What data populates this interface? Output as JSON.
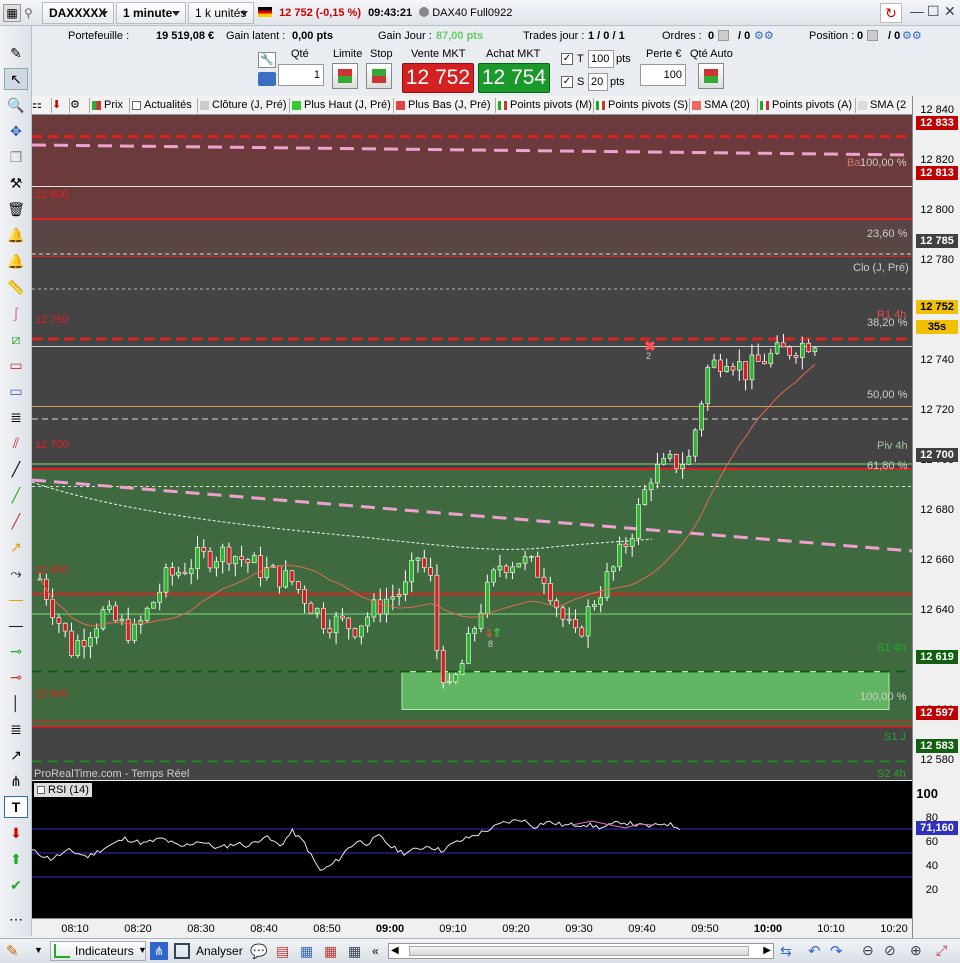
{
  "titlebar": {
    "instrument": "DAXXXXX",
    "timeframe": "1 minute",
    "units": "1 k unités",
    "last_quote": "12 752 (-0,15 %)",
    "time": "09:43:21",
    "contract": "DAX40 Full0922"
  },
  "account": {
    "portfolio_label": "Portefeuille :",
    "portfolio_value": "19 519,08 €",
    "latent_label": "Gain latent :",
    "latent_value": "0,00 pts",
    "day_label": "Gain Jour :",
    "day_value": "87,00 pts",
    "trades_label": "Trades jour :",
    "trades_value": "1 / 0 / 1",
    "orders_label": "Ordres :",
    "orders_value1": "0",
    "orders_value2": "/ 0",
    "position_label": "Position :",
    "position_value1": "0",
    "position_value2": "/ 0"
  },
  "order": {
    "qty_label": "Qté",
    "qty_value": "1",
    "limit_label": "Limite",
    "stop_label": "Stop",
    "sell_label": "Vente MKT",
    "sell_price": "12 752",
    "buy_label": "Achat MKT",
    "buy_price": "12 754",
    "t_label": "T",
    "t_value": "100",
    "s_label": "S",
    "s_value": "20",
    "pts": "pts",
    "loss_label": "Perte €",
    "loss_value": "100",
    "auto_label": "Qté Auto"
  },
  "indicators": [
    {
      "label": "Prix",
      "color": "#c04040"
    },
    {
      "label": "Actualités",
      "color": "#6060a0"
    },
    {
      "label": "Clôture (J, Pré)",
      "color": "#c0c0c0"
    },
    {
      "label": "Plus Haut (J, Pré)",
      "color": "#40a040"
    },
    {
      "label": "Plus Bas (J, Pré)",
      "color": "#d04040"
    },
    {
      "label": "Points pivots (M)",
      "color": "#208020"
    },
    {
      "label": "Points pivots (S)",
      "color": "#208020"
    },
    {
      "label": "SMA (20)",
      "color": "#e06060"
    },
    {
      "label": "Points pivots (A)",
      "color": "#208020"
    },
    {
      "label": "SMA (2",
      "color": "#d0d0d0"
    }
  ],
  "price_axis": {
    "ticks": [
      "12 840",
      "12 820",
      "12 800",
      "12 780",
      "12 760",
      "12 740",
      "12 720",
      "12 700",
      "12 680",
      "12 660",
      "12 640",
      "12 620",
      "12 600",
      "12 580"
    ],
    "boxes": [
      {
        "text": "12 833",
        "color": "#c00000"
      },
      {
        "text": "12 813",
        "color": "#c00000"
      },
      {
        "text": "12 785",
        "color": "#404040"
      },
      {
        "text": "12 752",
        "color": "#f0c000"
      },
      {
        "text": "35s",
        "color": "#f0c000"
      },
      {
        "text": "12 700",
        "color": "#404040"
      },
      {
        "text": "12 619",
        "color": "#106010"
      },
      {
        "text": "12 597",
        "color": "#c00000"
      },
      {
        "text": "12 583",
        "color": "#106010"
      }
    ]
  },
  "chart_labels": {
    "l_12800": "12 800",
    "l_12750": "12 750",
    "l_12700": "12 700",
    "l_12650": "12 650",
    "l_12600": "12 600",
    "fib_100_top": "100,00 %",
    "fib_236": "23,60 %",
    "clo": "Clo (J, Pré)",
    "fib_382": "38,20 %",
    "fib_50": "50,00 %",
    "piv4h": "Piv 4h",
    "fib_618": "61,80 %",
    "s1_4h": "S1 4h",
    "fib_100_bot": "100,00 %",
    "s1_j": "S1 J",
    "s2_4h": "S2 4h",
    "ba": "Ba",
    "r1": "R1 4h",
    "watermark": "ProRealTime.com - Temps Réel",
    "marker_2": "2",
    "marker_8": "8"
  },
  "rsi": {
    "label": "RSI (14)",
    "ticks": [
      "100",
      "80",
      "60",
      "40",
      "20"
    ],
    "box": "71,160"
  },
  "time_axis": [
    "08:10",
    "08:20",
    "08:30",
    "08:40",
    "08:50",
    "09:00",
    "09:10",
    "09:20",
    "09:30",
    "09:40",
    "09:50",
    "10:00",
    "10:10",
    "10:20"
  ],
  "bottombar": {
    "indicators_btn": "Indicateurs",
    "analyse_btn": "Analyser"
  },
  "colors": {
    "buy": "#1a9a2a",
    "sell": "#d42020",
    "up_candle": "#2db52d",
    "down_candle": "#d02020"
  }
}
